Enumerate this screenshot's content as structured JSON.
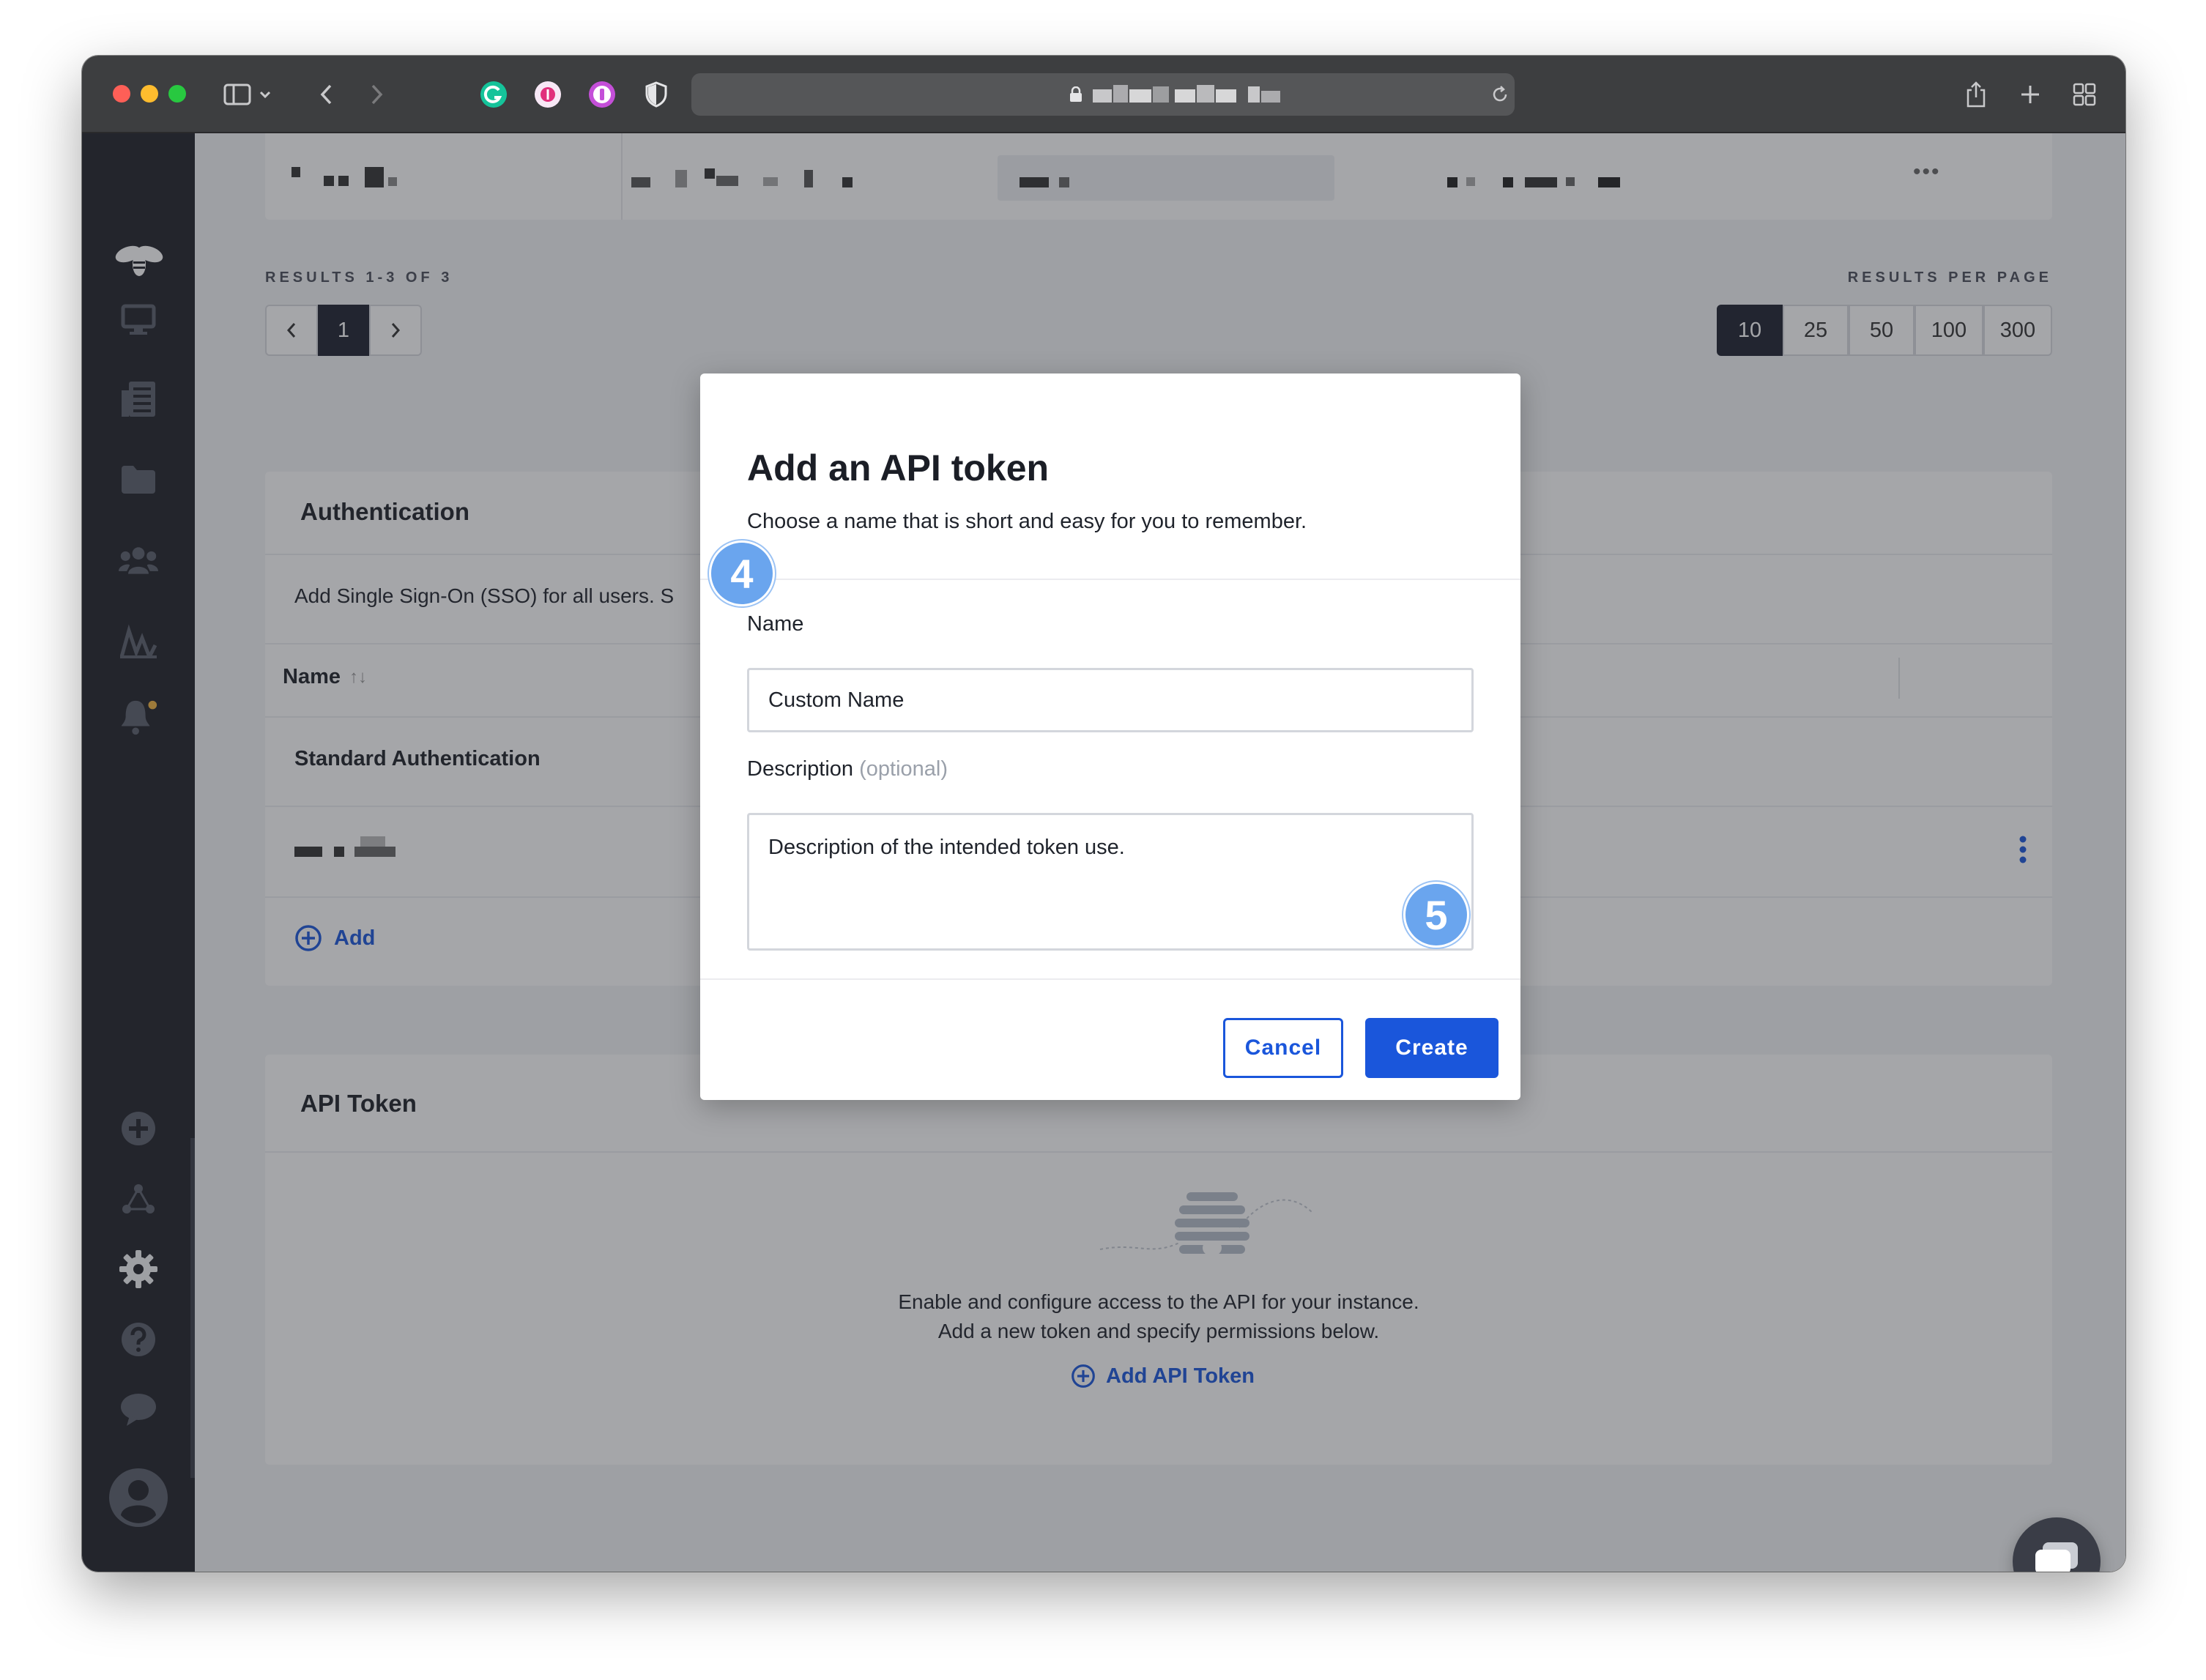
{
  "browser": {
    "url_masked": true
  },
  "table_top": {
    "menu_glyph": "•••"
  },
  "pagination": {
    "results_label": "RESULTS 1-3 OF 3",
    "prev_icon": "chevron-left-icon",
    "current_page": "1",
    "next_icon": "chevron-right-icon",
    "per_page_label": "RESULTS PER PAGE",
    "per_page_options": [
      "10",
      "25",
      "50",
      "100",
      "300"
    ],
    "per_page_selected": "10"
  },
  "authentication": {
    "title": "Authentication",
    "description": "Add Single Sign-On (SSO) for all users. S",
    "column_name": "Name",
    "sort_glyph": "↑↓",
    "rows": [
      "Standard Authentication"
    ],
    "add_label": "Add"
  },
  "api_token_section": {
    "title": "API Token",
    "empty_line1": "Enable and configure access to the API for your instance.",
    "empty_line2": "Add a new token and specify permissions below.",
    "add_label": "Add API Token"
  },
  "modal": {
    "title": "Add an API token",
    "subtitle": "Choose a name that is short and easy for you to remember.",
    "name_label": "Name",
    "name_value": "Custom Name",
    "description_label": "Description",
    "description_optional": "(optional)",
    "description_value": "Description of the intended token use.",
    "cancel_label": "Cancel",
    "create_label": "Create"
  },
  "annotations": {
    "step4": "4",
    "step5": "5"
  },
  "colors": {
    "sidebar": "#1f2129",
    "accent_blue": "#1a56db",
    "badge_blue": "#6aa5ee",
    "selected_page": "#1e2230"
  }
}
